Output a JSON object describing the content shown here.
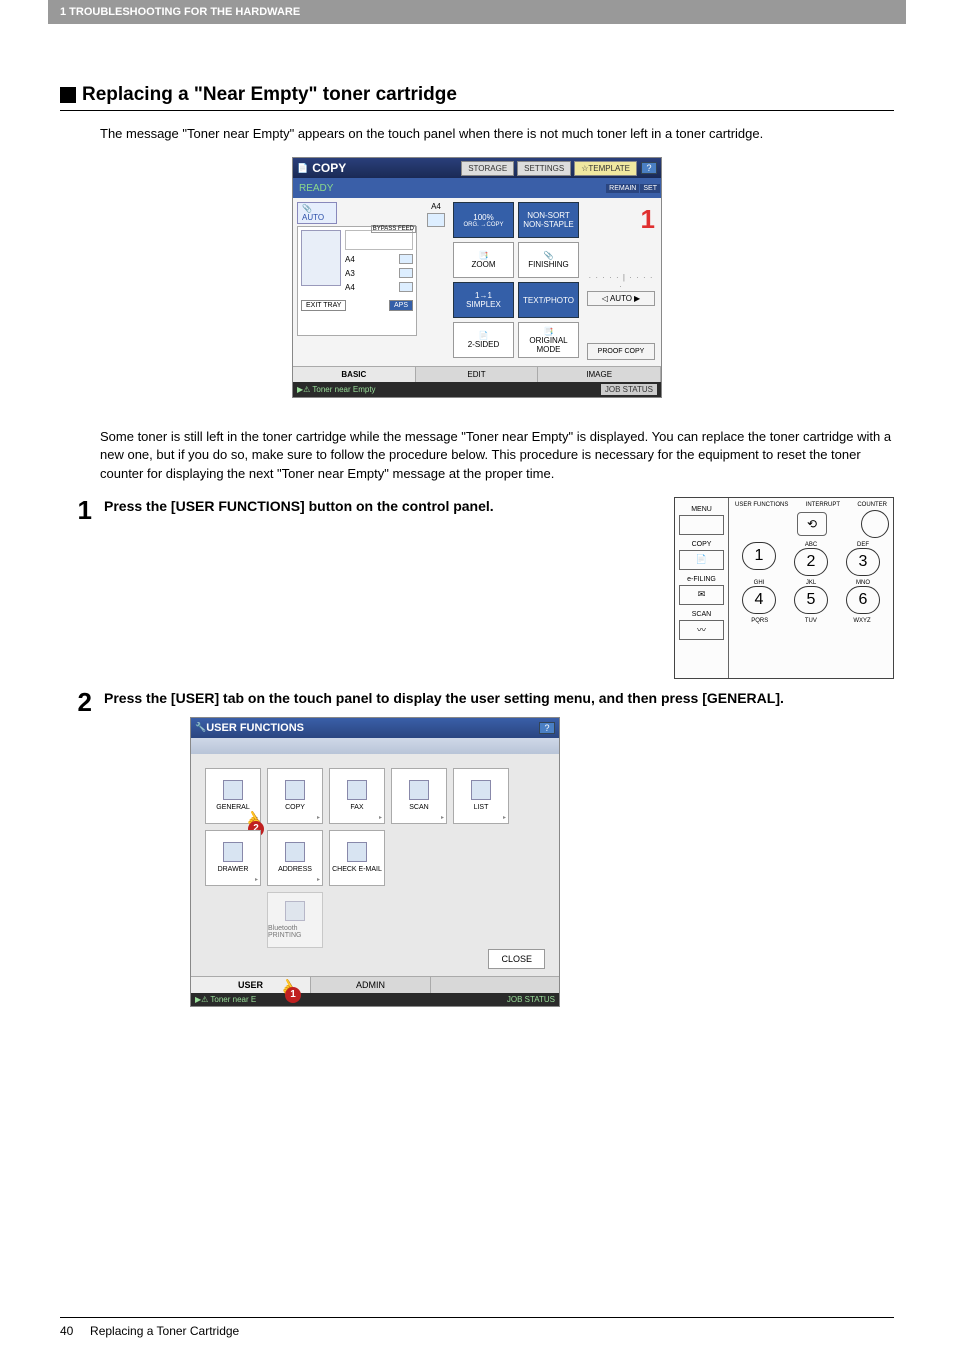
{
  "header": {
    "breadcrumb": "1 TROUBLESHOOTING FOR THE HARDWARE"
  },
  "section": {
    "title": "Replacing a \"Near Empty\" toner cartridge",
    "intro": "The message \"Toner near Empty\" appears on the touch panel when there is not much toner left in a toner cartridge.",
    "note": "Some toner is still left in the toner cartridge while the message \"Toner near Empty\" is displayed. You can replace the toner cartridge with a new one, but if you do so, make sure to follow the procedure below. This procedure is necessary for the equipment to reset the toner counter for displaying the next \"Toner near Empty\" message at the proper time."
  },
  "copy_screen": {
    "title": "COPY",
    "top_buttons": {
      "storage": "STORAGE",
      "settings": "SETTINGS",
      "template": "TEMPLATE",
      "help": "?"
    },
    "ready": "READY",
    "remain": "REMAIN",
    "set": "SET",
    "big_number": "1",
    "auto": "AUTO",
    "bypass": "BYPASS FEED",
    "trays": [
      "A4",
      "A3",
      "A4"
    ],
    "extra_tray": "A4",
    "exit": "EXIT TRAY",
    "aps": "APS",
    "zoom_pct": "100%",
    "orig_copy": "ORG. →COPY",
    "zoom": "ZOOM",
    "simplex_top": "1→1",
    "simplex": "SIMPLEX",
    "twosided": "2-SIDED",
    "nonsort": "NON-SORT NON-STAPLE",
    "finishing": "FINISHING",
    "textphoto": "TEXT/PHOTO",
    "origmode": "ORIGINAL MODE",
    "auto2": "AUTO",
    "proof": "PROOF COPY",
    "tabs": [
      "BASIC",
      "EDIT",
      "IMAGE"
    ],
    "status_msg": "Toner near Empty",
    "job_status": "JOB STATUS"
  },
  "steps": [
    {
      "num": "1",
      "text": "Press the [USER FUNCTIONS] button on the control panel."
    },
    {
      "num": "2",
      "text": "Press the [USER] tab on the touch panel to display the user setting menu, and then press [GENERAL]."
    }
  ],
  "control_panel": {
    "menu": "MENU",
    "copy": "COPY",
    "efiling": "e-FILING",
    "scan": "SCAN",
    "top_labels": {
      "uf": "USER FUNCTIONS",
      "interrupt": "INTERRUPT",
      "counter": "COUNTER"
    },
    "keypad": {
      "r1": [
        "1",
        "2",
        "3"
      ],
      "r1_letters": [
        "",
        "ABC",
        "DEF"
      ],
      "r2": [
        "4",
        "5",
        "6"
      ],
      "r2_letters": [
        "GHI",
        "JKL",
        "MNO"
      ],
      "r3_letters": [
        "PQRS",
        "TUV",
        "WXYZ"
      ]
    }
  },
  "uf_screen": {
    "title": "USER FUNCTIONS",
    "help": "?",
    "buttons": [
      "GENERAL",
      "COPY",
      "FAX",
      "SCAN",
      "LIST",
      "DRAWER",
      "ADDRESS",
      "CHECK E-MAIL",
      "Bluetooth PRINTING"
    ],
    "close": "CLOSE",
    "tabs": [
      "USER",
      "ADMIN"
    ],
    "status_msg": "Toner near E",
    "job_status": "JOB STATUS",
    "callouts": {
      "user_tab": "1",
      "general": "2"
    }
  },
  "footer": {
    "page": "40",
    "title": "Replacing a Toner Cartridge"
  }
}
